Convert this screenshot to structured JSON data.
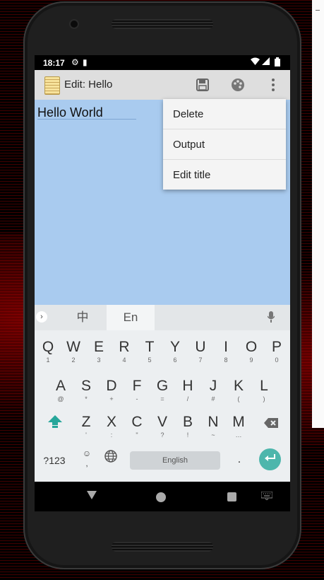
{
  "status_bar": {
    "time": "18:17"
  },
  "app_bar": {
    "title": "Edit: Hello"
  },
  "note": {
    "text": "Hello World"
  },
  "overflow_menu": {
    "items": [
      "Delete",
      "Output",
      "Edit title"
    ]
  },
  "keyboard": {
    "languages": [
      "中",
      "En"
    ],
    "row1": [
      {
        "key": "Q",
        "sub": "1"
      },
      {
        "key": "W",
        "sub": "2"
      },
      {
        "key": "E",
        "sub": "3"
      },
      {
        "key": "R",
        "sub": "4"
      },
      {
        "key": "T",
        "sub": "5"
      },
      {
        "key": "Y",
        "sub": "6"
      },
      {
        "key": "U",
        "sub": "7"
      },
      {
        "key": "I",
        "sub": "8"
      },
      {
        "key": "O",
        "sub": "9"
      },
      {
        "key": "P",
        "sub": "0"
      }
    ],
    "row2": [
      {
        "key": "A",
        "sub": "@"
      },
      {
        "key": "S",
        "sub": "*"
      },
      {
        "key": "D",
        "sub": "+"
      },
      {
        "key": "F",
        "sub": "-"
      },
      {
        "key": "G",
        "sub": "="
      },
      {
        "key": "H",
        "sub": "/"
      },
      {
        "key": "J",
        "sub": "#"
      },
      {
        "key": "K",
        "sub": "("
      },
      {
        "key": "L",
        "sub": ")"
      }
    ],
    "row3": [
      {
        "key": "Z",
        "sub": "'"
      },
      {
        "key": "X",
        "sub": ":"
      },
      {
        "key": "C",
        "sub": "\""
      },
      {
        "key": "V",
        "sub": "?"
      },
      {
        "key": "B",
        "sub": "!"
      },
      {
        "key": "N",
        "sub": "~"
      },
      {
        "key": "M",
        "sub": "…"
      }
    ],
    "symbols_label": "?123",
    "emoji_sub": ",",
    "space_label": "English",
    "period": "."
  },
  "icons": {
    "app": "notepad-icon",
    "save": "save-icon",
    "palette": "palette-icon",
    "more": "more-vert-icon",
    "mic": "microphone-icon",
    "globe": "globe-icon",
    "shift": "shift-icon",
    "backspace": "backspace-icon",
    "enter": "enter-icon"
  },
  "colors": {
    "content_bg": "#a9cbef",
    "accent": "#4db6ac",
    "appbar_bg": "#dedede"
  }
}
